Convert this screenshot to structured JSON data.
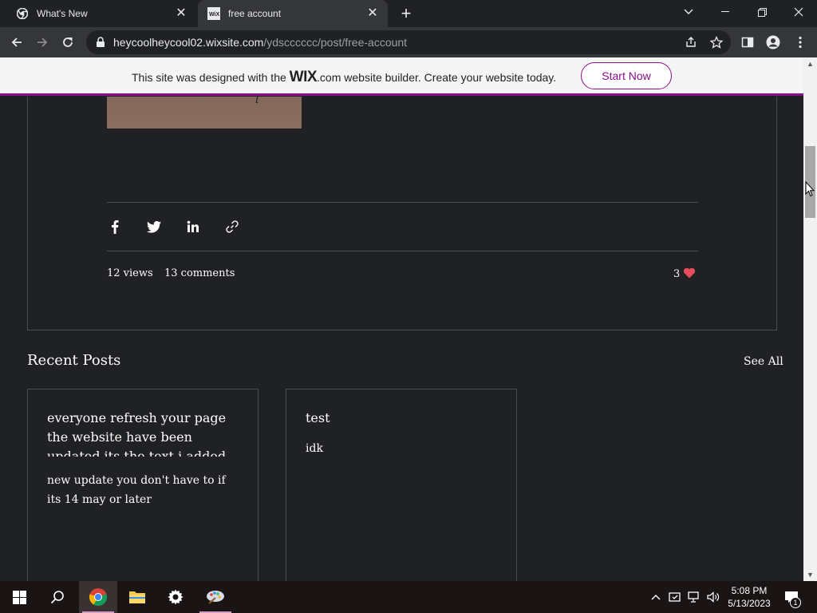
{
  "browser": {
    "tabs": [
      {
        "title": "What's New"
      },
      {
        "title": "free account"
      }
    ],
    "url_host": "heycoolheycool02.wixsite.com",
    "url_path": "/ydscccccc/post/free-account"
  },
  "banner": {
    "text_before": "This site was designed with the ",
    "brand": "WIX",
    "text_after": ".com website builder. Create your website today.",
    "cta": "Start Now"
  },
  "post": {
    "image_text": "l",
    "views": "12 views",
    "comments": "13 comments",
    "likes": "3"
  },
  "recent": {
    "title": "Recent Posts",
    "see_all": "See All",
    "posts": [
      {
        "title": "everyone refresh your page the website have been updated its the text i added",
        "excerpt": "new update you don't have to if its 14 may or later"
      },
      {
        "title": "test",
        "excerpt": "idk"
      }
    ]
  },
  "taskbar": {
    "time": "5:08 PM",
    "date": "5/13/2023",
    "notification_count": "1"
  },
  "colors": {
    "accent": "#8a0f8a",
    "page_bg": "#202124",
    "heart": "#e74c5b"
  }
}
